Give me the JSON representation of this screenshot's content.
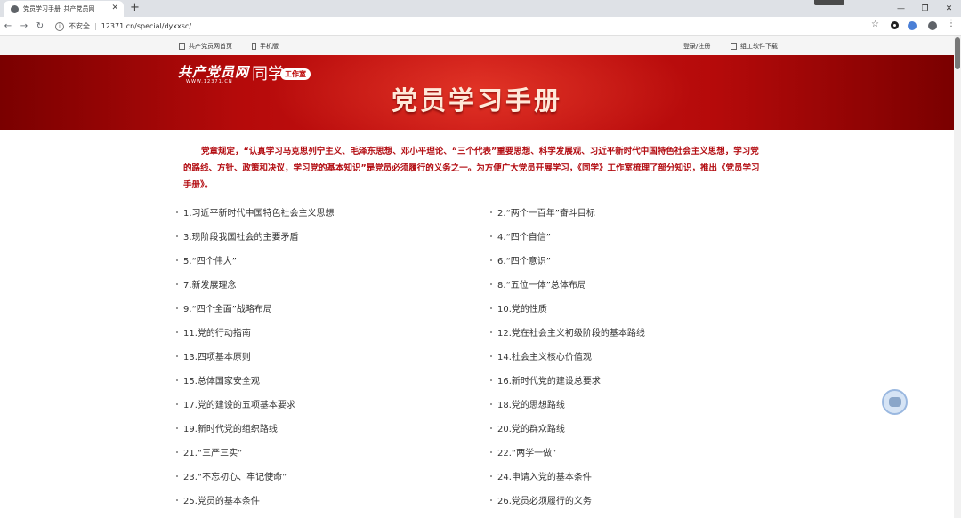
{
  "browser": {
    "tab_title": "党员学习手册_共产党员网",
    "tab_close": "✕",
    "new_tab": "+",
    "security_label": "不安全",
    "url": "12371.cn/special/dyxxsc/",
    "win_minimize": "—",
    "win_restore": "❐",
    "win_close": "✕"
  },
  "topnav": {
    "home_link": "共产党员网首页",
    "mobile_link": "手机版",
    "login_link": "登录/注册",
    "download_link": "组工软件下载"
  },
  "banner": {
    "logo_text": "共产党员网",
    "logo_url": "WWW.12371.CN",
    "tongxue": "同学",
    "studio_badge": "工作室",
    "title": "党员学习手册"
  },
  "intro": "党章规定，“认真学习马克思列宁主义、毛泽东思想、邓小平理论、“三个代表”重要思想、科学发展观、习近平新时代中国特色社会主义思想，学习党的路线、方针、政策和决议，学习党的基本知识”是党员必须履行的义务之一。为方便广大党员开展学习，《同学》工作室梳理了部分知识，推出《党员学习手册》。",
  "items": [
    "1.习近平新时代中国特色社会主义思想",
    "2.“两个一百年”奋斗目标",
    "3.现阶段我国社会的主要矛盾",
    "4.“四个自信”",
    "5.“四个伟大”",
    "6.“四个意识”",
    "7.新发展理念",
    "8.“五位一体”总体布局",
    "9.“四个全面”战略布局",
    "10.党的性质",
    "11.党的行动指南",
    "12.党在社会主义初级阶段的基本路线",
    "13.四项基本原则",
    "14.社会主义核心价值观",
    "15.总体国家安全观",
    "16.新时代党的建设总要求",
    "17.党的建设的五项基本要求",
    "18.党的思想路线",
    "19.新时代党的组织路线",
    "20.党的群众路线",
    "21.“三严三实”",
    "22.“两学一做”",
    "23.“不忘初心、牢记使命”",
    "24.申请入党的基本条件",
    "25.党员的基本条件",
    "26.党员必须履行的义务"
  ],
  "colors": {
    "banner_red": "#c81414",
    "intro_red": "#b30d12"
  }
}
